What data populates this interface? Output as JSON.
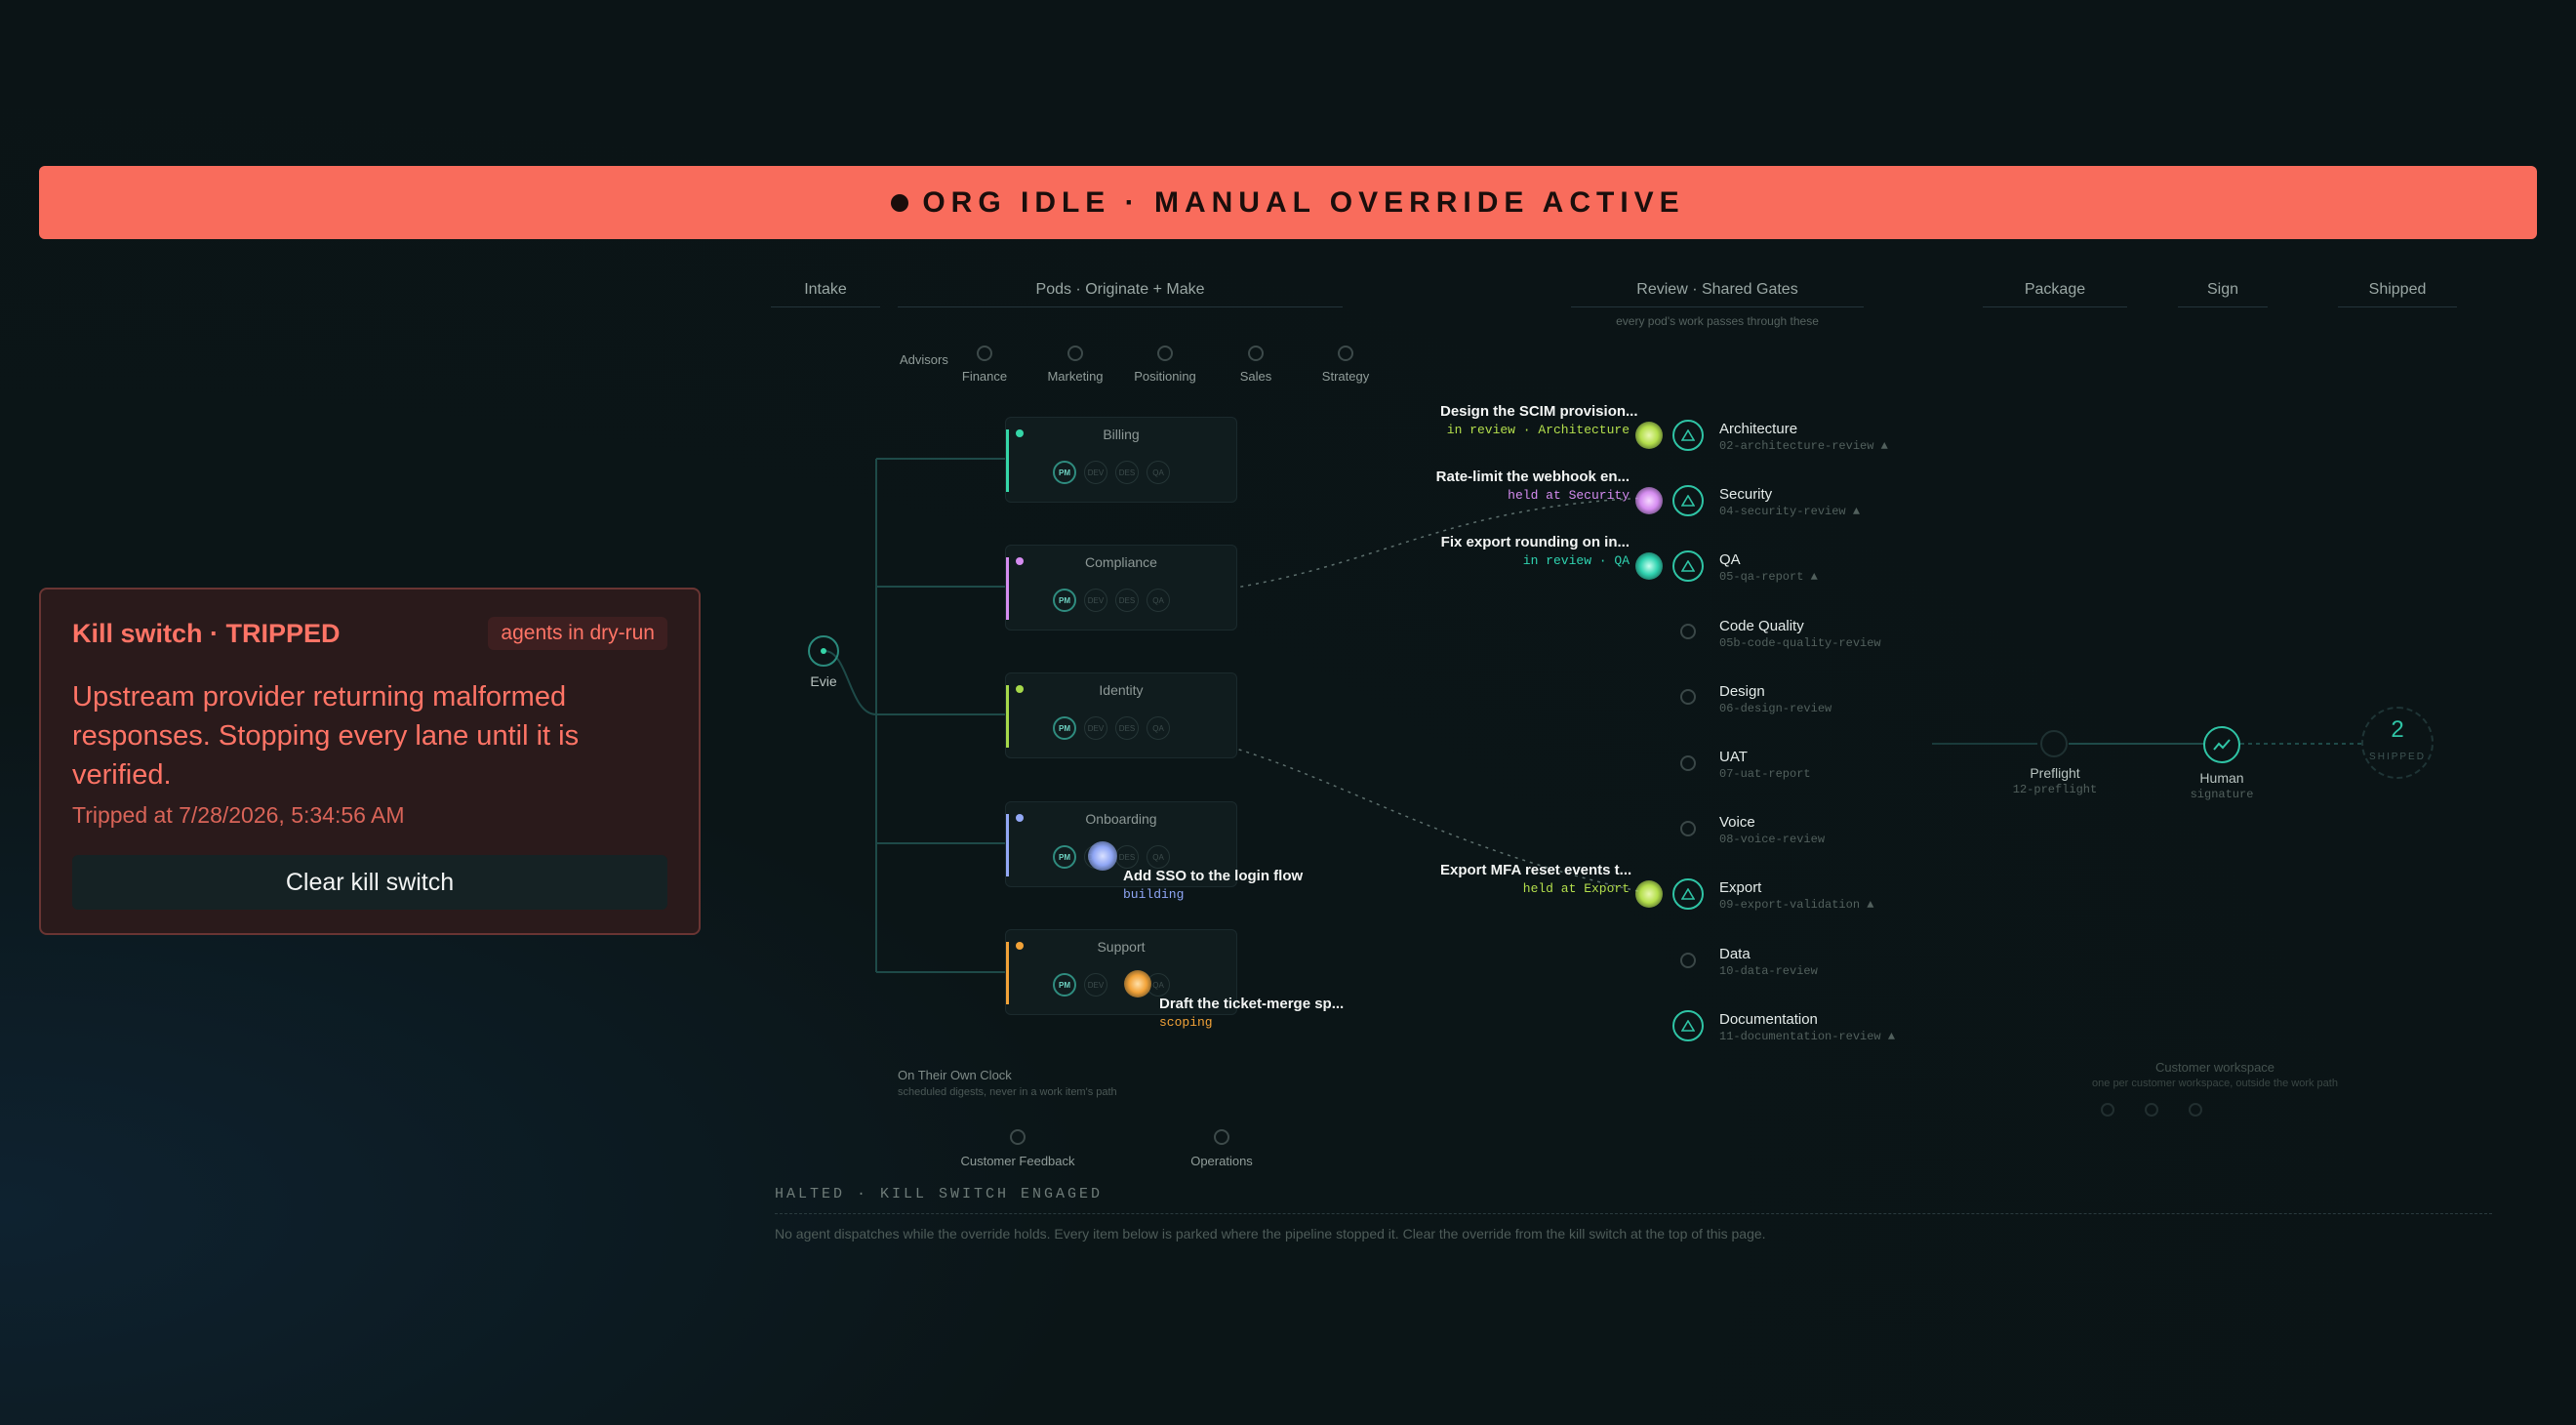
{
  "banner": {
    "text": "ORG IDLE · MANUAL OVERRIDE ACTIVE"
  },
  "kill_switch": {
    "title": "Kill switch · TRIPPED",
    "badge": "agents in dry-run",
    "message": "Upstream provider returning malformed responses. Stopping every lane until it is verified.",
    "tripped_at": "Tripped at 7/28/2026, 5:34:56 AM",
    "clear_button": "Clear kill switch"
  },
  "columns": {
    "intake": "Intake",
    "pods": "Pods · Originate + Make",
    "review": "Review · Shared Gates",
    "review_sub": "every pod's work passes through these",
    "package": "Package",
    "sign": "Sign",
    "shipped": "Shipped"
  },
  "advisors": {
    "label": "Advisors",
    "items": [
      "Finance",
      "Marketing",
      "Positioning",
      "Sales",
      "Strategy"
    ]
  },
  "intake": {
    "name": "Evie"
  },
  "pods": [
    {
      "name": "Billing",
      "color": "#35d6a8",
      "chips": [
        "PM",
        "DEV",
        "DES",
        "QA"
      ]
    },
    {
      "name": "Compliance",
      "color": "#d58cf0",
      "chips": [
        "PM",
        "DEV",
        "DES",
        "QA"
      ]
    },
    {
      "name": "Identity",
      "color": "#a6d84a",
      "chips": [
        "PM",
        "DEV",
        "DES",
        "QA"
      ]
    },
    {
      "name": "Onboarding",
      "color": "#93a8f5",
      "chips": [
        "PM",
        "DEV",
        "DES",
        "QA"
      ]
    },
    {
      "name": "Support",
      "color": "#f2a238",
      "chips": [
        "PM",
        "DEV",
        "QA"
      ]
    }
  ],
  "pod_tasks": [
    {
      "title": "Add SSO to the login flow",
      "status": "building",
      "color": "#8fa6f5"
    },
    {
      "title": "Draft the ticket-merge sp...",
      "status": "scoping",
      "color": "#f2a238"
    }
  ],
  "review_tasks": [
    {
      "title": "Design the SCIM provision...",
      "status": "in review · Architecture",
      "color": "#b4df4c"
    },
    {
      "title": "Rate-limit the webhook en...",
      "status": "held at Security",
      "color": "#d58cf0"
    },
    {
      "title": "Fix export rounding on in...",
      "status": "in review · QA",
      "color": "#2fd3b0"
    },
    {
      "title": "Export MFA reset events t...",
      "status": "held at Export",
      "color": "#b4df4c"
    }
  ],
  "gates": [
    {
      "name": "Architecture",
      "code": "02-architecture-review ▲"
    },
    {
      "name": "Security",
      "code": "04-security-review ▲"
    },
    {
      "name": "QA",
      "code": "05-qa-report ▲"
    },
    {
      "name": "Code Quality",
      "code": "05b-code-quality-review"
    },
    {
      "name": "Design",
      "code": "06-design-review"
    },
    {
      "name": "UAT",
      "code": "07-uat-report"
    },
    {
      "name": "Voice",
      "code": "08-voice-review"
    },
    {
      "name": "Export",
      "code": "09-export-validation ▲"
    },
    {
      "name": "Data",
      "code": "10-data-review"
    },
    {
      "name": "Documentation",
      "code": "11-documentation-review ▲"
    }
  ],
  "package": {
    "name": "Preflight",
    "code": "12-preflight"
  },
  "sign": {
    "name": "Human",
    "code": "signature"
  },
  "shipped": {
    "count": "2",
    "label": "SHIPPED"
  },
  "own_clock": {
    "title": "On Their Own Clock",
    "sub": "scheduled digests, never in a work item's path",
    "items": [
      "Customer Feedback",
      "Operations"
    ]
  },
  "customer_ws": {
    "title": "Customer workspace",
    "sub": "one per customer workspace, outside the work path"
  },
  "halted": {
    "heading": "HALTED · KILL SWITCH ENGAGED",
    "text": "No agent dispatches while the override holds. Every item below is parked where the pipeline stopped it. Clear the override from the kill switch at the top of this page."
  }
}
